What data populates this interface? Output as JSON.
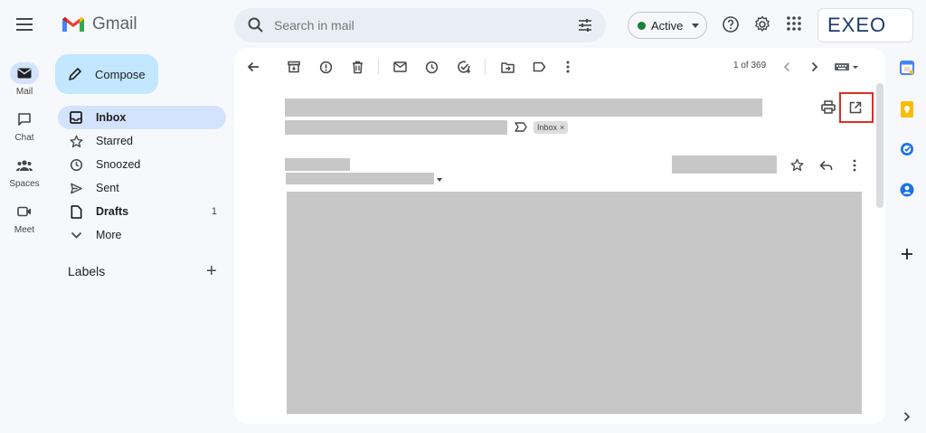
{
  "app": {
    "name": "Gmail"
  },
  "search": {
    "placeholder": "Search in mail"
  },
  "status": {
    "label": "Active",
    "color": "#188038"
  },
  "brand": {
    "text": "EXEO"
  },
  "rail": [
    {
      "label": "Mail",
      "icon": "mail-icon"
    },
    {
      "label": "Chat",
      "icon": "chat-icon"
    },
    {
      "label": "Spaces",
      "icon": "spaces-icon"
    },
    {
      "label": "Meet",
      "icon": "meet-icon"
    }
  ],
  "compose": {
    "label": "Compose"
  },
  "nav": [
    {
      "label": "Inbox",
      "icon": "inbox-icon",
      "count": ""
    },
    {
      "label": "Starred",
      "icon": "star-icon",
      "count": ""
    },
    {
      "label": "Snoozed",
      "icon": "clock-icon",
      "count": ""
    },
    {
      "label": "Sent",
      "icon": "send-icon",
      "count": ""
    },
    {
      "label": "Drafts",
      "icon": "draft-icon",
      "count": "1"
    },
    {
      "label": "More",
      "icon": "chevron-down-icon",
      "count": ""
    }
  ],
  "labels": {
    "title": "Labels"
  },
  "message": {
    "pager": "1 of 369",
    "label_chip": "Inbox",
    "label_chip_remove": "×"
  },
  "colors": {
    "accent": "#c2e7ff",
    "active_nav": "#d3e3fd",
    "highlight": "#d93025",
    "redacted": "#c7c7c7"
  }
}
